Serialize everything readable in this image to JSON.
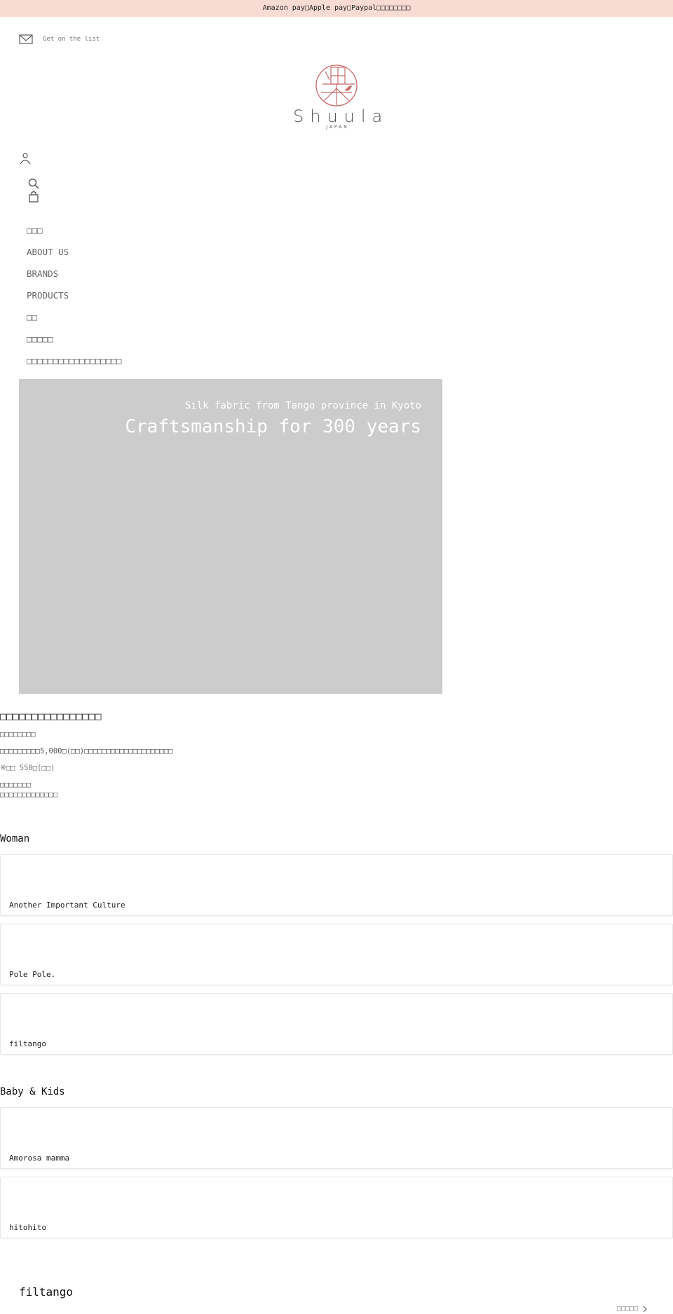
{
  "announcement": "Amazon pay□Apple pay□Paypal□□□□□□□□",
  "newsletter": {
    "icon": "mail-icon",
    "label": "Get on the list"
  },
  "logo": {
    "wordmark": "Shuula",
    "subtitle": "JAPAN",
    "accent_color": "#c86b6b"
  },
  "header_icons": {
    "account": "account-icon",
    "search": "search-icon",
    "cart": "bag-icon"
  },
  "nav": {
    "items": [
      {
        "label": "□□□"
      },
      {
        "label": "ABOUT US"
      },
      {
        "label": "BRANDS"
      },
      {
        "label": "PRODUCTS"
      },
      {
        "label": "□□"
      },
      {
        "label": "□□□□□"
      },
      {
        "label": "□□□□□□□□□□□□□□□□□□"
      }
    ]
  },
  "hero": {
    "subtitle": "Silk fabric from Tango province in Kyoto",
    "title": "Craftsmanship for 300 years",
    "bg_color": "#cccccc"
  },
  "notice": {
    "heading": "□□□□□□□□□□□□□□□□",
    "line1": "□□□□□□□□",
    "line2": "□□□□□□□□□5,000□(□□)□□□□□□□□□□□□□□□□□□□□",
    "line3": "※□□ 550□(□□)",
    "line4": "□□□□□□□",
    "line5": "□□□□□□□□□□□□□"
  },
  "sections": [
    {
      "title": "Woman",
      "brands": [
        "Another Important Culture",
        "Pole Pole.",
        "filtango"
      ]
    },
    {
      "title": "Baby & Kids",
      "brands": [
        "Amorosa mamma",
        "hitohito"
      ]
    }
  ],
  "featured": {
    "title": "filtango",
    "view_all": "□□□□□",
    "chevron": "chevron-right-icon"
  }
}
